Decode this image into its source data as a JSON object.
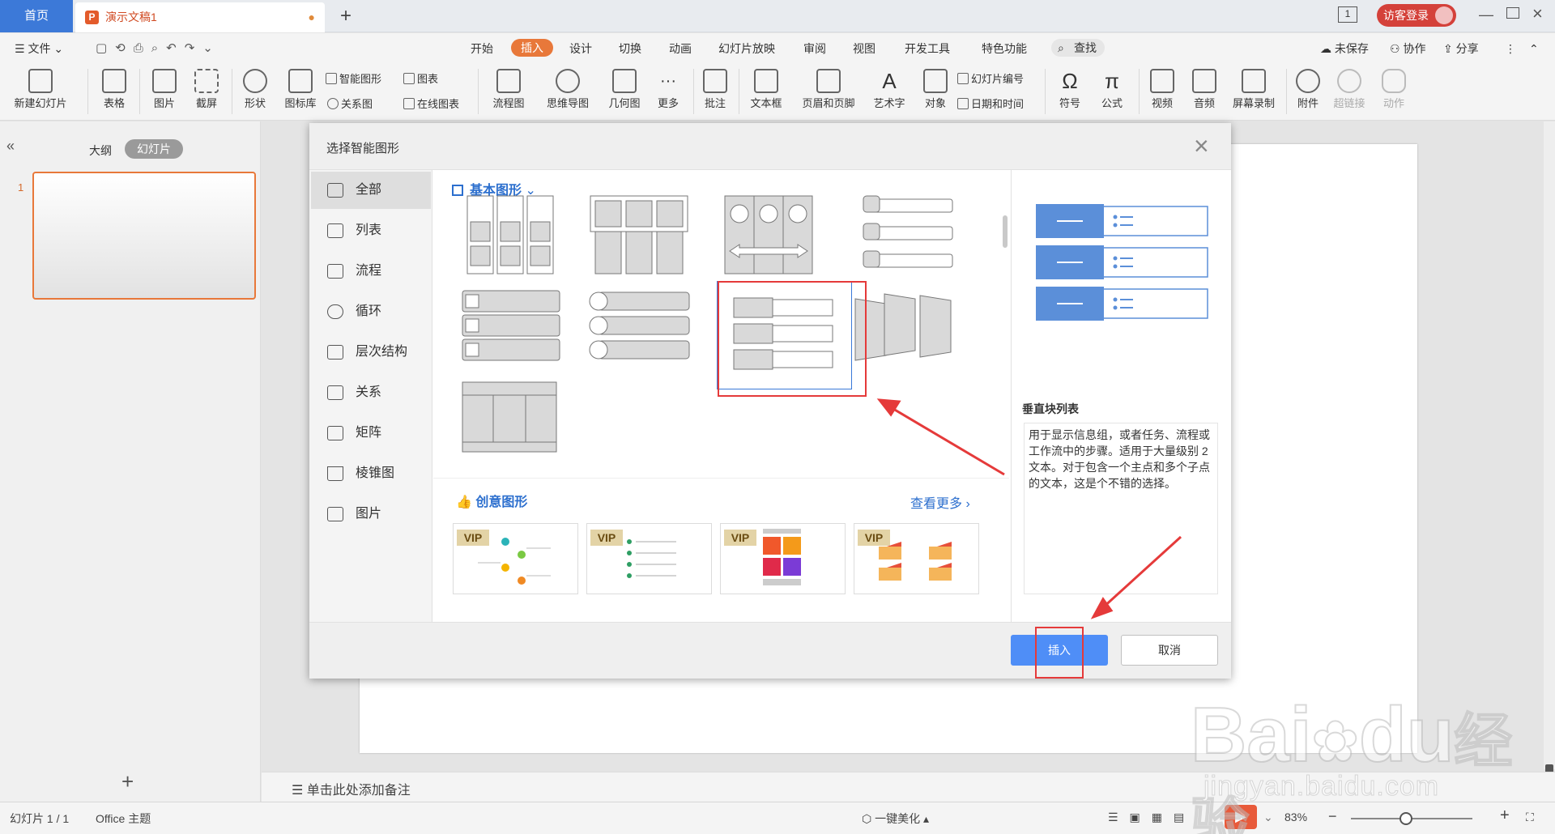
{
  "tabbar": {
    "home": "首页",
    "doc_title": "演示文稿1",
    "doc_modified": "●",
    "new_tab": "+",
    "login": "访客登录"
  },
  "menu": {
    "file": "文件",
    "tabs": [
      "开始",
      "插入",
      "设计",
      "切换",
      "动画",
      "幻灯片放映",
      "审阅",
      "视图",
      "开发工具",
      "特色功能"
    ],
    "search": "查找",
    "unsaved": "未保存",
    "collab": "协作",
    "share": "分享"
  },
  "ribbon": {
    "new_slide": "新建幻灯片",
    "table": "表格",
    "picture": "图片",
    "screenshot": "截屏",
    "shape": "形状",
    "icon_lib": "图标库",
    "smart_art": "智能图形",
    "chart": "图表",
    "relation": "关系图",
    "online_chart": "在线图表",
    "flowchart": "流程图",
    "mindmap": "思维导图",
    "geometry": "几何图",
    "more": "更多",
    "comment": "批注",
    "textbox": "文本框",
    "header_footer": "页眉和页脚",
    "wordart": "艺术字",
    "object": "对象",
    "slide_number": "幻灯片编号",
    "datetime": "日期和时间",
    "symbol": "符号",
    "formula": "公式",
    "video": "视频",
    "audio": "音频",
    "screen_record": "屏幕录制",
    "attachment": "附件",
    "hyperlink": "超链接",
    "action": "动作"
  },
  "leftpane": {
    "outline": "大纲",
    "slides": "幻灯片",
    "slide_number": "1",
    "collapse": "«",
    "add": "+"
  },
  "notes": {
    "placeholder": "单击此处添加备注"
  },
  "statusbar": {
    "slide_info": "幻灯片 1 / 1",
    "theme": "Office 主题",
    "beautify": "一键美化",
    "zoom": "83%"
  },
  "dialog": {
    "title": "选择智能图形",
    "close": "×",
    "categories": [
      "全部",
      "列表",
      "流程",
      "循环",
      "层次结构",
      "关系",
      "矩阵",
      "棱锥图",
      "图片"
    ],
    "section_basic": "基本图形",
    "section_creative": "创意图形",
    "see_more": "查看更多",
    "vip": "VIP",
    "preview_title": "垂直块列表",
    "preview_desc": "用于显示信息组，或者任务、流程或工作流中的步骤。适用于大量级别 2 文本。对于包含一个主点和多个子点的文本，这是个不错的选择。",
    "insert": "插入",
    "cancel": "取消"
  },
  "watermark": {
    "brand": "Bai",
    "brand2": "du",
    "cn": "经验",
    "url": "jingyan.baidu.com"
  },
  "colors": {
    "accent": "#e8783a",
    "primary": "#4f8ef7",
    "highlight": "#e53a3a",
    "home_tab": "#3c79d8"
  }
}
